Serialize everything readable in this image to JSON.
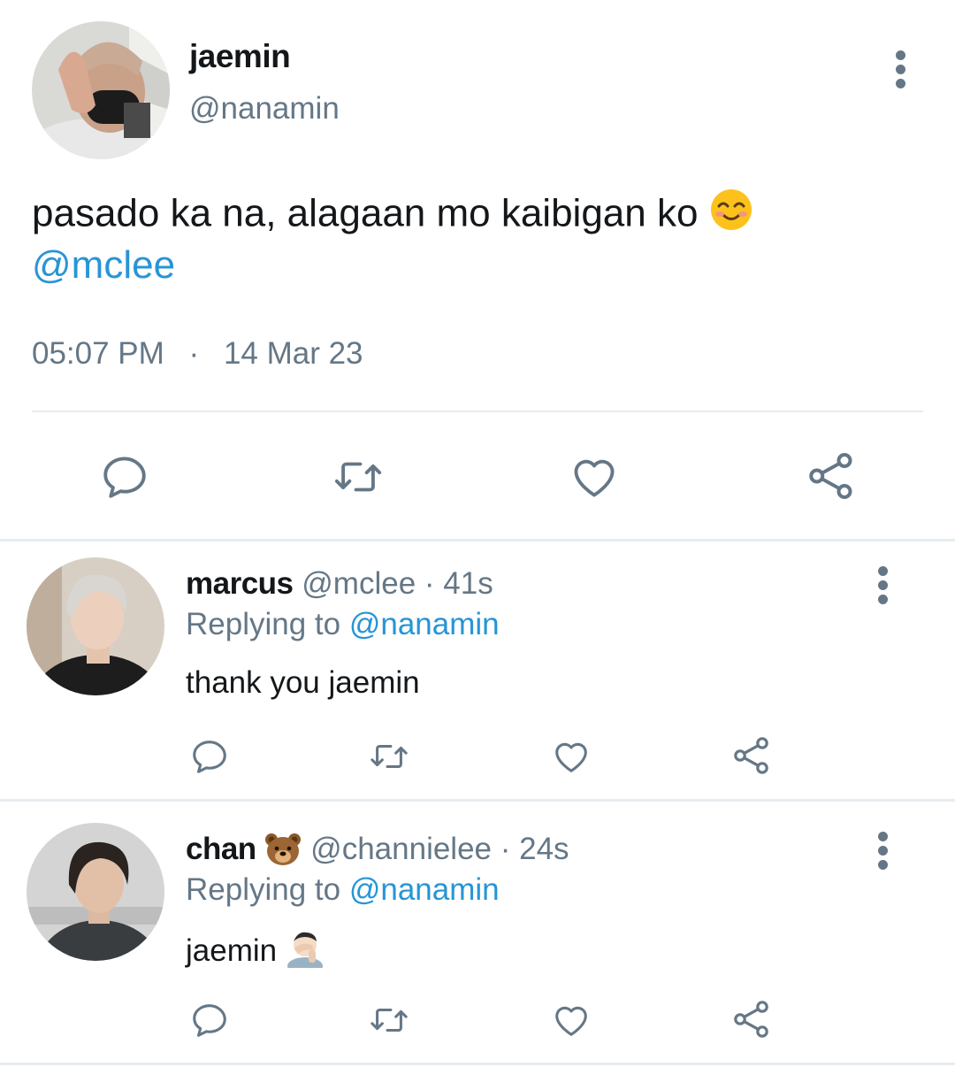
{
  "main_tweet": {
    "display_name": "jaemin",
    "handle": "@nanamin",
    "text": "pasado ka na, alagaan mo kaibigan ko",
    "text_emoji": "smiling-face-emoji",
    "mention": "@mclee",
    "time": "05:07 PM",
    "separator": "·",
    "date": "14 Mar 23"
  },
  "replies": [
    {
      "display_name": "marcus",
      "handle": "@mclee",
      "age": "· 41s",
      "replying_prefix": "Replying to",
      "replying_to": "@nanamin",
      "text": "thank you jaemin"
    },
    {
      "display_name": "chan",
      "name_emoji": "bear-face-emoji",
      "handle": "@channielee",
      "age": "· 24s",
      "replying_prefix": "Replying to",
      "replying_to": "@nanamin",
      "text": "jaemin",
      "text_emoji": "facepalm-emoji"
    }
  ],
  "actions": [
    "reply-icon",
    "retweet-icon",
    "like-icon",
    "share-icon"
  ],
  "colors": {
    "icon_grey": "#657786",
    "link_blue": "#2795d6",
    "divider": "#e6ecf0"
  }
}
